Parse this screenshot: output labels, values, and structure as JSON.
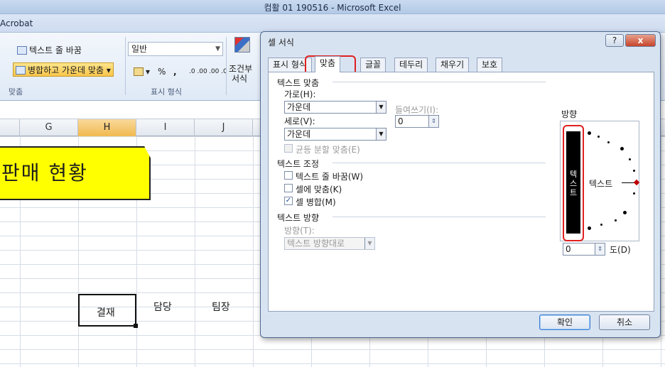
{
  "window": {
    "title": "컴활 01 190516 - Microsoft Excel"
  },
  "tabstrip": {
    "acrobat": "Acrobat"
  },
  "ribbon": {
    "wrap_text": "텍스트 줄 바꿈",
    "merge_center": "병합하고 가운데 맞춤",
    "alignment_group": "맞춤",
    "number_format": "일반",
    "percent": "%",
    "comma": ",",
    "number_group": "표시 형식",
    "conditional": "조건부",
    "conditional2": "서식",
    "dec_inc": ".0 .00",
    "dec_dec": ".00 .0"
  },
  "sheet": {
    "columns": [
      "G",
      "H",
      "I",
      "J"
    ],
    "selected_column": "H",
    "banner_text": "판매 현황",
    "cells": {
      "approval": "결재",
      "staff": "담당",
      "team_lead": "팀장"
    }
  },
  "dialog": {
    "title": "셀 서식",
    "help": "?",
    "close": "x",
    "tabs": [
      "표시 형식",
      "맞춤",
      "글꼴",
      "테두리",
      "채우기",
      "보호"
    ],
    "active_tab": "맞춤",
    "text_alignment": {
      "section": "텍스트 맞춤",
      "horizontal_label": "가로(H):",
      "horizontal_value": "가운데",
      "indent_label": "들여쓰기(I):",
      "indent_value": "0",
      "vertical_label": "세로(V):",
      "vertical_value": "가운데",
      "justify_distributed": "균등 분할 맞춤(E)"
    },
    "text_control": {
      "section": "텍스트 조정",
      "wrap": "텍스트 줄 바꿈(W)",
      "shrink": "셀에 맞춤(K)",
      "merge": "셀 병합(M)",
      "merge_checked": true
    },
    "text_direction": {
      "section": "텍스트 방향",
      "label": "방향(T):",
      "value": "텍스트 방향대로"
    },
    "orientation": {
      "section": "방향",
      "vertical_text": "텍스트",
      "horizontal_text": "텍스트",
      "degrees_value": "0",
      "degrees_label": "도(D)"
    },
    "ok": "확인",
    "cancel": "취소"
  }
}
